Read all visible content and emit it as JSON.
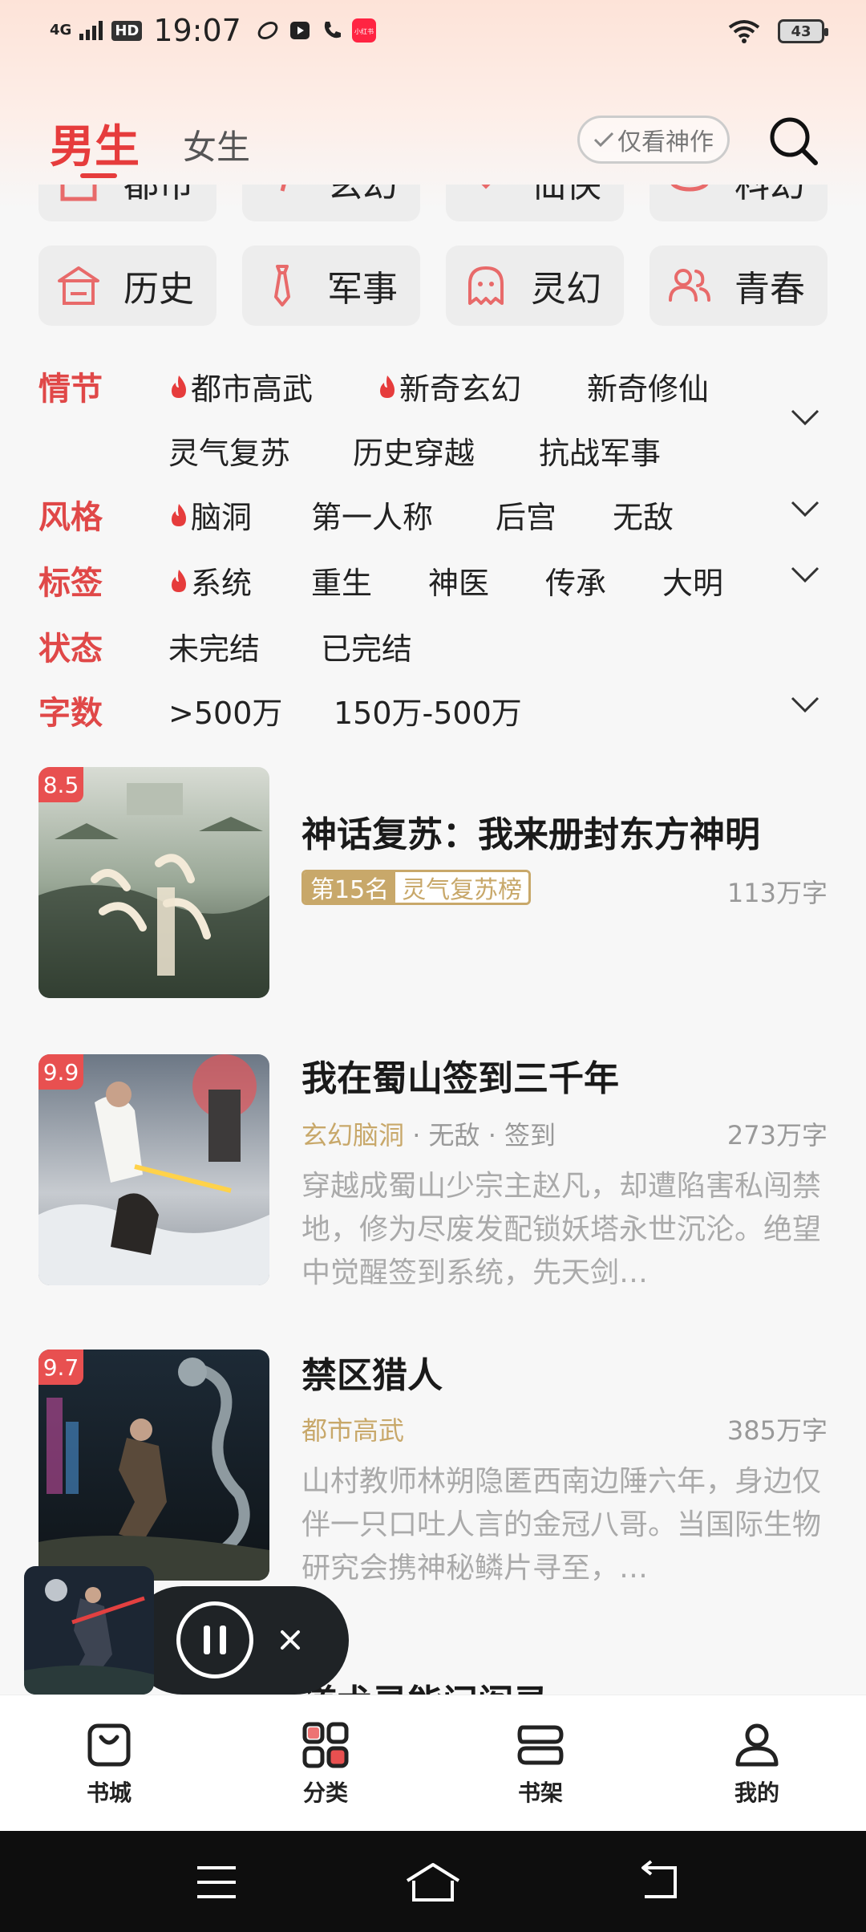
{
  "status_bar": {
    "network": "4G",
    "hd": "HD",
    "time": "19:07",
    "notif_badge": "小红书",
    "battery": "43"
  },
  "header": {
    "tab_male": "男生",
    "tab_female": "女生",
    "only_masterpiece": "仅看神作"
  },
  "categories_partial": [
    "都市",
    "玄幻",
    "仙侠",
    "科幻"
  ],
  "categories": [
    {
      "label": "历史",
      "icon": "temple-icon"
    },
    {
      "label": "军事",
      "icon": "tie-icon"
    },
    {
      "label": "灵幻",
      "icon": "ghost-icon"
    },
    {
      "label": "青春",
      "icon": "people-icon"
    }
  ],
  "filters": {
    "plot": {
      "label": "情节",
      "items": [
        "都市高武",
        "新奇玄幻",
        "新奇修仙",
        "灵气复苏",
        "历史穿越",
        "抗战军事"
      ]
    },
    "style": {
      "label": "风格",
      "items": [
        "脑洞",
        "第一人称",
        "后宫",
        "无敌"
      ]
    },
    "tags": {
      "label": "标签",
      "items": [
        "系统",
        "重生",
        "神医",
        "传承",
        "大明"
      ]
    },
    "status": {
      "label": "状态",
      "items": [
        "未完结",
        "已完结"
      ]
    },
    "words": {
      "label": "字数",
      "items": [
        ">500万",
        "150万-500万"
      ]
    }
  },
  "books": [
    {
      "score": "8.5",
      "title": "神话复苏：我来册封东方神明",
      "rank_a": "第15名",
      "rank_b": "灵气复苏榜",
      "words": "113万字"
    },
    {
      "score": "9.9",
      "title": "我在蜀山签到三千年",
      "tag_gold": "玄幻脑洞",
      "tags_rest": " · 无敌 · 签到",
      "words": "273万字",
      "desc": "穿越成蜀山少宗主赵凡，却遭陷害私闯禁地，修为尽废发配锁妖塔永世沉沦。绝望中觉醒签到系统，先天剑…"
    },
    {
      "score": "9.7",
      "title": "禁区猎人",
      "tag_gold": "都市高武",
      "words": "385万字",
      "desc": "山村教师林朔隐匿西南边陲六年，身边仅伴一只口吐人言的金冠八哥。当国际生物研究会携神秘鳞片寻至，…"
    }
  ],
  "next_book_partial": "道术灵能问阎录",
  "bottom_nav": [
    {
      "label": "书城",
      "icon": "bag-icon"
    },
    {
      "label": "分类",
      "icon": "grid-icon"
    },
    {
      "label": "书架",
      "icon": "shelf-icon"
    },
    {
      "label": "我的",
      "icon": "user-icon"
    }
  ],
  "colors": {
    "accent": "#e63c3c",
    "filter_label": "#e04848",
    "gold": "#c8a86a"
  }
}
